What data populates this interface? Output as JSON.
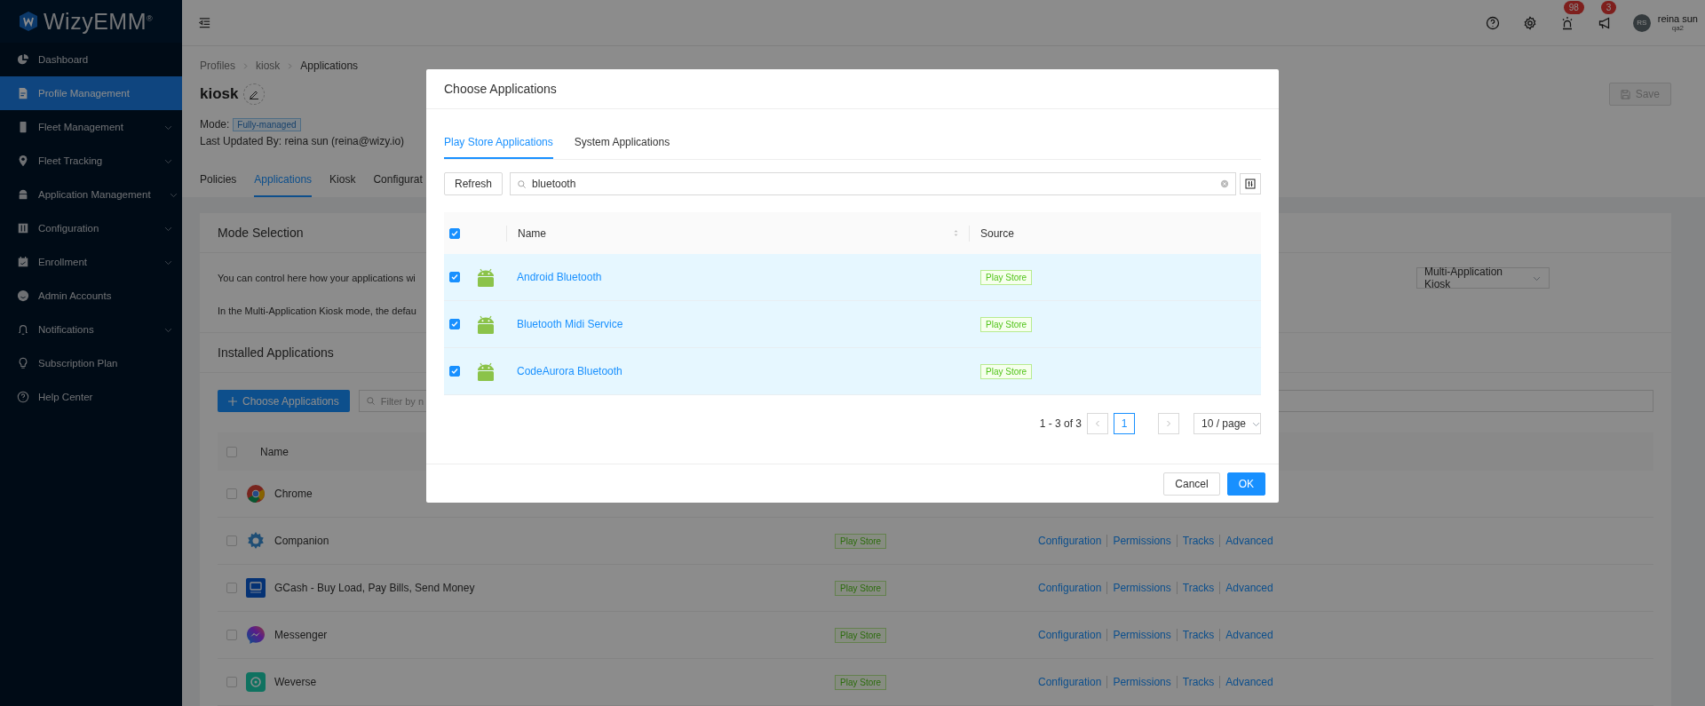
{
  "brand": {
    "name": "WizyEMM$^{®}$"
  },
  "sidebar": {
    "items": [
      {
        "label": "Dashboard",
        "selected": false,
        "expandable": false
      },
      {
        "label": "Profile Management",
        "selected": true,
        "expandable": false
      },
      {
        "label": "Fleet Management",
        "selected": false,
        "expandable": true
      },
      {
        "label": "Fleet Tracking",
        "selected": false,
        "expandable": true
      },
      {
        "label": "Application Management",
        "selected": false,
        "expandable": true
      },
      {
        "label": "Configuration",
        "selected": false,
        "expandable": true
      },
      {
        "label": "Enrollment",
        "selected": false,
        "expandable": true
      },
      {
        "label": "Admin Accounts",
        "selected": false,
        "expandable": false
      },
      {
        "label": "Notifications",
        "selected": false,
        "expandable": true
      },
      {
        "label": "Subscription Plan",
        "selected": false,
        "expandable": false
      },
      {
        "label": "Help Center",
        "selected": false,
        "expandable": false
      }
    ]
  },
  "topbar": {
    "icons": [
      {
        "kind": "help"
      },
      {
        "kind": "settings"
      },
      {
        "kind": "alarm",
        "badge": "98"
      },
      {
        "kind": "megaphone",
        "badge": "3"
      }
    ],
    "user": {
      "initials": "RS",
      "name": "reina sun",
      "org": "qa2"
    }
  },
  "breadcrumb": [
    "Profiles",
    "kiosk",
    "Applications"
  ],
  "profile": {
    "title": "kiosk",
    "mode_label": "Mode:",
    "mode": "Fully-managed",
    "last_updated": "Last Updated By: reina sun (reina@wizy.io)",
    "save": {
      "label": "Save",
      "disabled": true
    }
  },
  "profile_tabs": [
    {
      "label": "Policies",
      "selected": false
    },
    {
      "label": "Applications",
      "selected": true
    },
    {
      "label": "Kiosk",
      "selected": false
    },
    {
      "label": "Configurat",
      "selected": false
    }
  ],
  "mode_selection": {
    "title": "Mode Selection",
    "lines": [
      "You can control here how your applications wi",
      "In the Multi-Application Kiosk mode, the defau"
    ],
    "dropdown": "Multi-Application Kiosk"
  },
  "installed": {
    "title": "Installed Applications",
    "choose_button": "Choose Applications",
    "filter_placeholder": "Filter by n",
    "name_column": "Name",
    "all_checked": false,
    "rows": [
      {
        "name": "Chrome",
        "checked": false
      },
      {
        "name": "Companion",
        "checked": false,
        "source": "Play Store",
        "actions": [
          "Configuration",
          "Permissions",
          "Tracks",
          "Advanced"
        ]
      },
      {
        "name": "GCash - Buy Load, Pay Bills, Send Money",
        "checked": false,
        "source": "Play Store",
        "actions": [
          "Configuration",
          "Permissions",
          "Tracks",
          "Advanced"
        ]
      },
      {
        "name": "Messenger",
        "checked": false,
        "source": "Play Store",
        "actions": [
          "Configuration",
          "Permissions",
          "Tracks",
          "Advanced"
        ]
      },
      {
        "name": "Weverse",
        "checked": false,
        "source": "Play Store",
        "actions": [
          "Configuration",
          "Permissions",
          "Tracks",
          "Advanced"
        ]
      }
    ]
  },
  "modal": {
    "title": "Choose Applications",
    "tabs": [
      {
        "label": "Play Store Applications",
        "selected": true
      },
      {
        "label": "System Applications",
        "selected": false
      }
    ],
    "refresh": "Refresh",
    "search": {
      "value": "bluetooth"
    },
    "table": {
      "all_checked": true,
      "columns": [
        "Name",
        "Source"
      ],
      "rows": [
        {
          "name": "Android Bluetooth",
          "source": "Play Store",
          "checked": true
        },
        {
          "name": "Bluetooth Midi Service",
          "source": "Play Store",
          "checked": true
        },
        {
          "name": "CodeAurora Bluetooth",
          "source": "Play Store",
          "checked": true
        }
      ]
    },
    "pagination": {
      "range": "1 - 3 of 3",
      "pages": [
        {
          "label": "1",
          "selected": true
        }
      ],
      "page_size": "10 / page"
    },
    "buttons": [
      {
        "label": "Cancel",
        "kind": "default"
      },
      {
        "label": "OK",
        "kind": "primary"
      }
    ]
  }
}
